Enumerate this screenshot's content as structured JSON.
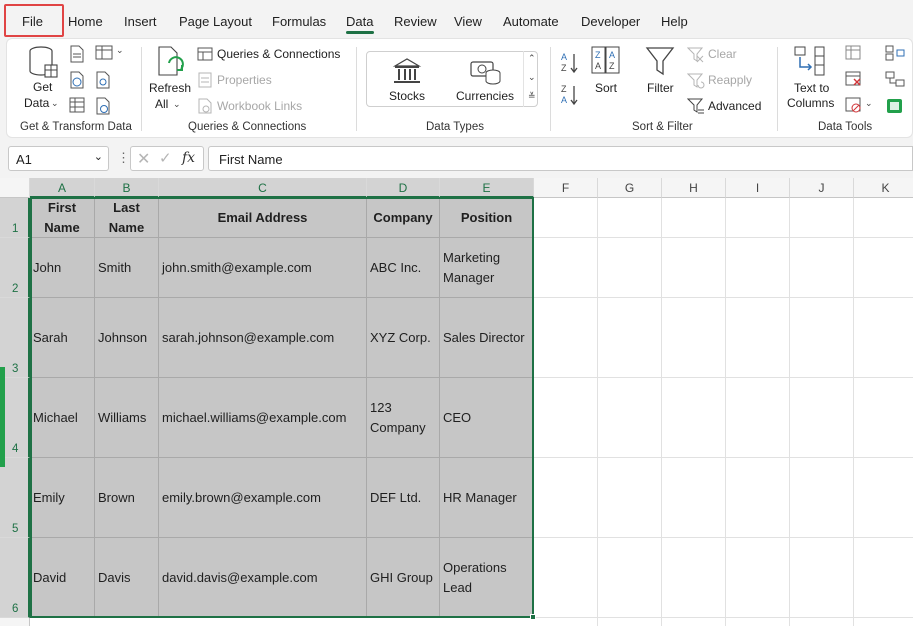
{
  "tabs": [
    {
      "label": "File"
    },
    {
      "label": "Home"
    },
    {
      "label": "Insert"
    },
    {
      "label": "Page Layout"
    },
    {
      "label": "Formulas"
    },
    {
      "label": "Data"
    },
    {
      "label": "Review"
    },
    {
      "label": "View"
    },
    {
      "label": "Automate"
    },
    {
      "label": "Developer"
    },
    {
      "label": "Help"
    }
  ],
  "active_tab": "Data",
  "ribbon": {
    "get_transform": {
      "get_data_line1": "Get",
      "get_data_line2": "Data",
      "group_label": "Get & Transform Data"
    },
    "queries": {
      "refresh_line1": "Refresh",
      "refresh_line2": "All",
      "queries_connections": "Queries & Connections",
      "properties": "Properties",
      "workbook_links": "Workbook Links",
      "group_label": "Queries & Connections"
    },
    "data_types": {
      "stocks": "Stocks",
      "currencies": "Currencies",
      "group_label": "Data Types"
    },
    "sort_filter": {
      "sort": "Sort",
      "filter": "Filter",
      "clear": "Clear",
      "reapply": "Reapply",
      "advanced": "Advanced",
      "group_label": "Sort & Filter"
    },
    "data_tools": {
      "text_to_columns_line1": "Text to",
      "text_to_columns_line2": "Columns",
      "group_label": "Data Tools"
    }
  },
  "formula_bar": {
    "name_box": "A1",
    "fx": "fx",
    "formula": "First Name"
  },
  "columns": [
    "A",
    "B",
    "C",
    "D",
    "E",
    "F",
    "G",
    "H",
    "I",
    "J",
    "K"
  ],
  "rows": [
    "1",
    "2",
    "3",
    "4",
    "5",
    "6"
  ],
  "table": {
    "headers": [
      [
        "First",
        "Name"
      ],
      [
        "Last",
        "Name"
      ],
      [
        "Email Address"
      ],
      [
        "Company"
      ],
      [
        "Position"
      ]
    ],
    "rows": [
      [
        [
          "John"
        ],
        [
          "Smith"
        ],
        [
          "john.smith@example.com"
        ],
        [
          "ABC Inc."
        ],
        [
          "Marketing",
          "Manager"
        ]
      ],
      [
        [
          "Sarah"
        ],
        [
          "Johnson"
        ],
        [
          "sarah.johnson@example.com"
        ],
        [
          "XYZ Corp."
        ],
        [
          "Sales Director"
        ]
      ],
      [
        [
          "Michael"
        ],
        [
          "Williams"
        ],
        [
          "michael.williams@example.com"
        ],
        [
          "123",
          "Company"
        ],
        [
          "CEO"
        ]
      ],
      [
        [
          "Emily"
        ],
        [
          "Brown"
        ],
        [
          "emily.brown@example.com"
        ],
        [
          "DEF Ltd."
        ],
        [
          "HR Manager"
        ]
      ],
      [
        [
          "David"
        ],
        [
          "Davis"
        ],
        [
          "david.davis@example.com"
        ],
        [
          "GHI Group"
        ],
        [
          "Operations",
          "Lead"
        ]
      ]
    ]
  },
  "colors": {
    "accent": "#1e7145",
    "selection_fill": "#c6c6c6",
    "file_highlight": "#e04444"
  }
}
